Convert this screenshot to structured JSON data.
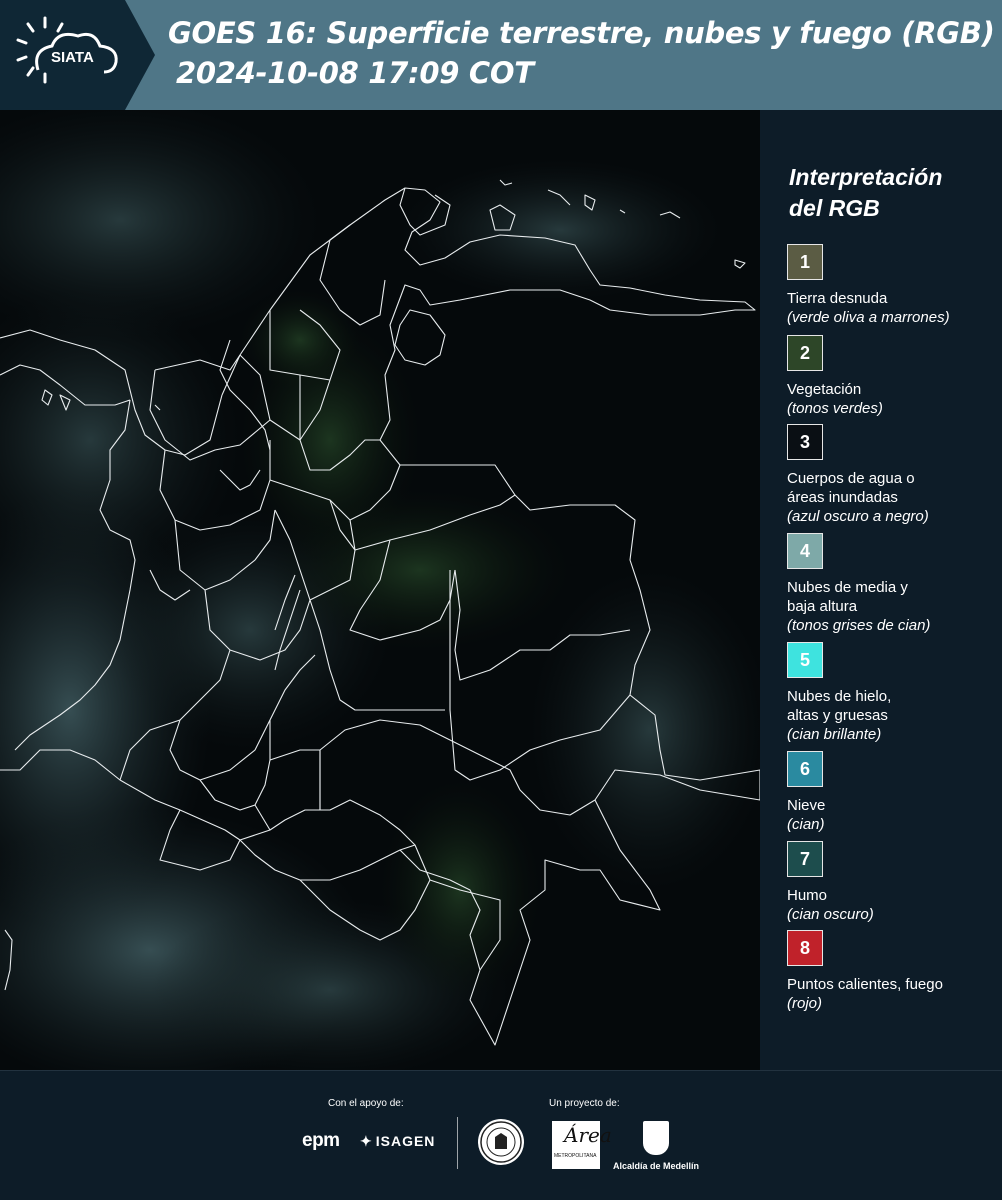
{
  "header": {
    "logo_text": "SIATA",
    "title_line1": "GOES 16: Superficie terrestre, nubes y fuego (RGB)",
    "title_line2": "2024-10-08 17:09 COT"
  },
  "legend": {
    "title_line1": "Interpretación",
    "title_line2": "del RGB",
    "items": [
      {
        "num": "1",
        "label1": "Tierra desnuda",
        "label2": "",
        "sub": "(verde oliva a marrones)",
        "color": "#5b5c44"
      },
      {
        "num": "2",
        "label1": "Vegetación",
        "label2": "",
        "sub": "(tonos verdes)",
        "color": "#2d4628"
      },
      {
        "num": "3",
        "label1": "Cuerpos de agua o",
        "label2": "áreas inundadas",
        "sub": "(azul oscuro a negro)",
        "color": "#0a0f14"
      },
      {
        "num": "4",
        "label1": "Nubes de media y",
        "label2": "baja altura",
        "sub": "(tonos grises de cian)",
        "color": "#7ea9a8"
      },
      {
        "num": "5",
        "label1": "Nubes de hielo,",
        "label2": "altas y gruesas",
        "sub": "(cian brillante)",
        "color": "#3ee3df"
      },
      {
        "num": "6",
        "label1": "Nieve",
        "label2": "",
        "sub": "(cian)",
        "color": "#2a8aa0"
      },
      {
        "num": "7",
        "label1": "Humo",
        "label2": "",
        "sub": "(cian oscuro)",
        "color": "#1d4d4d"
      },
      {
        "num": "8",
        "label1": "Puntos calientes, fuego",
        "label2": "",
        "sub": "(rojo)",
        "color": "#c0222a"
      }
    ]
  },
  "footer": {
    "support_label": "Con el apoyo de:",
    "project_label": "Un proyecto de:",
    "epm": "epm",
    "isagen": "ISAGEN",
    "area_text": "Área",
    "area_sub": "METROPOLITANA",
    "medellin": "Alcaldía de Medellín"
  }
}
